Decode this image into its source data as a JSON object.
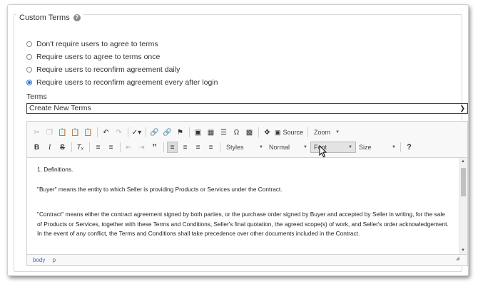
{
  "section": {
    "title": "Custom Terms",
    "help_icon": "question-circle-icon"
  },
  "radios": [
    {
      "label": "Don't require users to agree to terms",
      "checked": false
    },
    {
      "label": "Require users to agree to terms once",
      "checked": false
    },
    {
      "label": "Require users to reconfirm agreement daily",
      "checked": false
    },
    {
      "label": "Require users to reconfirm agreement every after login",
      "checked": true
    }
  ],
  "terms": {
    "label": "Terms",
    "selected": "Create New Terms"
  },
  "toolbar": {
    "source_label": "Source",
    "zoom_label": "Zoom",
    "styles_label": "Styles",
    "format_label": "Normal",
    "font_label": "Font",
    "size_label": "Size",
    "help_label": "?"
  },
  "content": {
    "paragraphs": [
      "1. Definitions.",
      "\"Buyer\" means the entity to which Seller is providing Products or Services under the Contract.",
      "\"Contract\" means either the contract agreement signed by both parties, or the purchase order signed by Buyer and accepted by Seller in writing, for the sale of Products or Services, together with these Terms and Conditions, Seller's final quotation, the agreed scope(s) of work, and Seller's order acknowledgement. In the event of any conflict, the Terms and Conditions shall take precedence over other documents included in the Contract."
    ]
  },
  "statusbar": {
    "path": [
      "body",
      "p"
    ]
  },
  "colors": {
    "accent": "#2a6fc9",
    "border": "#d1d1d1"
  }
}
